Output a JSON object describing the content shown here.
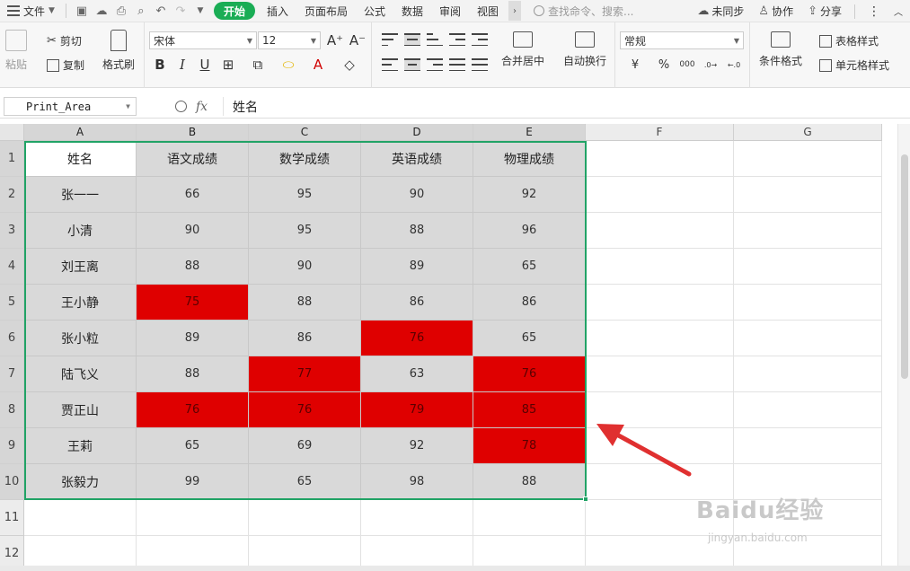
{
  "menubar": {
    "file_label": "文件",
    "tabs": [
      {
        "label": "开始",
        "active": true
      },
      {
        "label": "插入",
        "active": false
      },
      {
        "label": "页面布局",
        "active": false
      },
      {
        "label": "公式",
        "active": false
      },
      {
        "label": "数据",
        "active": false
      },
      {
        "label": "审阅",
        "active": false
      },
      {
        "label": "视图",
        "active": false
      }
    ],
    "search_placeholder": "查找命令、搜索...",
    "right": {
      "sync": "未同步",
      "collab": "协作",
      "share": "分享"
    }
  },
  "ribbon": {
    "paste": "粘贴",
    "cut": "剪切",
    "copy": "复制",
    "format_painter": "格式刷",
    "font_name": "宋体",
    "font_size": "12",
    "merge_center": "合并居中",
    "wrap_text": "自动换行",
    "number_format": "常规",
    "currency": "¥",
    "percent": "%",
    "thousands": "000",
    "conditional_format": "条件格式",
    "table_style": "表格样式",
    "cell_style": "单元格样式",
    "accent_color": "#1aad55"
  },
  "formula_bar": {
    "name_box": "Print_Area",
    "fx_label": "fx",
    "formula": "姓名"
  },
  "grid": {
    "columns": [
      "A",
      "B",
      "C",
      "D",
      "E",
      "F",
      "G"
    ],
    "rows": [
      "1",
      "2",
      "3",
      "4",
      "5",
      "6",
      "7",
      "8",
      "9",
      "10",
      "11",
      "12"
    ],
    "headers": [
      "姓名",
      "语文成绩",
      "数学成绩",
      "英语成绩",
      "物理成绩"
    ],
    "data": [
      [
        "张一一",
        "66",
        "95",
        "90",
        "92"
      ],
      [
        "小清",
        "90",
        "95",
        "88",
        "96"
      ],
      [
        "刘王离",
        "88",
        "90",
        "89",
        "65"
      ],
      [
        "王小静",
        "75",
        "88",
        "86",
        "86"
      ],
      [
        "张小粒",
        "89",
        "86",
        "76",
        "65"
      ],
      [
        "陆飞义",
        "88",
        "77",
        "63",
        "76"
      ],
      [
        "贾正山",
        "76",
        "76",
        "79",
        "85"
      ],
      [
        "王莉",
        "65",
        "69",
        "92",
        "78"
      ],
      [
        "张毅力",
        "99",
        "65",
        "98",
        "88"
      ]
    ],
    "highlight": [
      [
        false,
        false,
        false,
        false,
        false
      ],
      [
        false,
        false,
        false,
        false,
        false
      ],
      [
        false,
        false,
        false,
        false,
        false
      ],
      [
        false,
        true,
        false,
        false,
        false
      ],
      [
        false,
        false,
        false,
        true,
        false
      ],
      [
        false,
        false,
        true,
        false,
        true
      ],
      [
        false,
        true,
        true,
        true,
        true
      ],
      [
        false,
        false,
        false,
        false,
        true
      ],
      [
        false,
        false,
        false,
        false,
        false
      ]
    ],
    "highlight_color": "#df0000",
    "selection_color": "#21a366"
  },
  "watermark": {
    "brand": "Baidu经验",
    "url": "jingyan.baidu.com"
  },
  "annotation_color": "#e03030"
}
